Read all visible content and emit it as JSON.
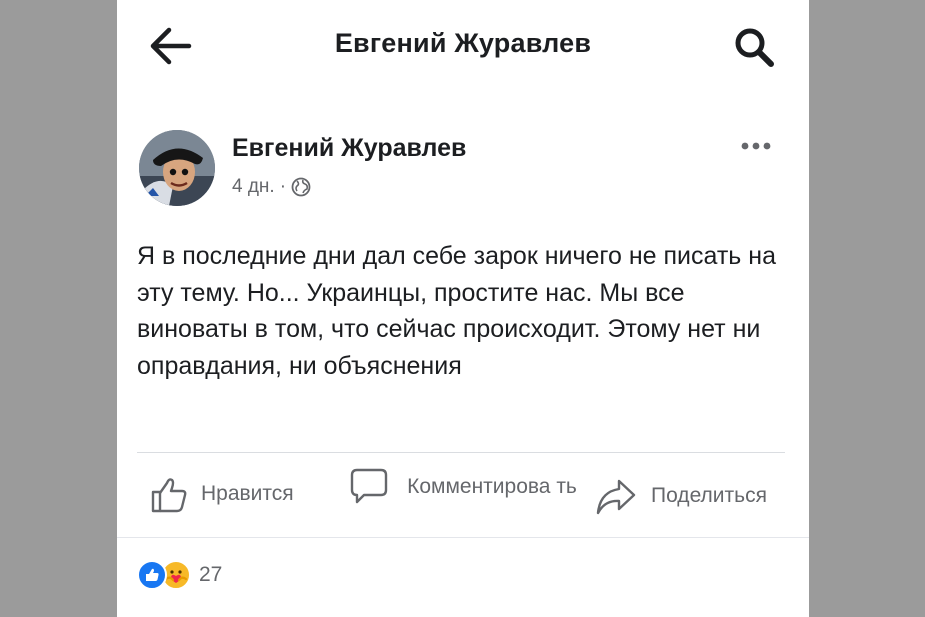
{
  "header": {
    "back_icon": "arrow-left-icon",
    "title": "Евгений Журавлев",
    "search_icon": "search-icon"
  },
  "post": {
    "author": "Евгений Журавлев",
    "time": "4 дн.",
    "separator": "·",
    "privacy_icon": "globe-icon",
    "more_icon": "more-dots-icon",
    "text": "Я в последние дни дал себе зарок ничего не писать на эту тему. Но... Украинцы, простите нас. Мы все виноваты в том, что сейчас происходит. Этому нет ни оправдания, ни объяснения"
  },
  "actions": {
    "like_label": "Нравится",
    "comment_label": "Комментирова ть",
    "share_label": "Поделиться"
  },
  "reactions": {
    "icons": [
      "like-reaction-icon",
      "care-reaction-icon"
    ],
    "count": "27"
  },
  "colors": {
    "background": "#9b9b9b",
    "panel": "#ffffff",
    "text": "#1c1e21",
    "secondary": "#65676b",
    "like_blue": "#1877f2",
    "care_yellow": "#f7b928"
  }
}
